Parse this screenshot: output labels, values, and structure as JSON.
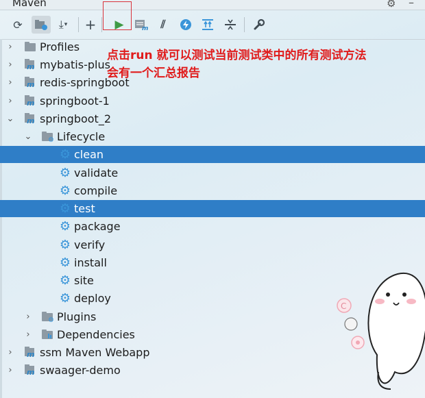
{
  "window": {
    "title": "Maven"
  },
  "toolbar": {
    "buttons": [
      {
        "name": "reload-icon",
        "glyph": "⟳"
      },
      {
        "name": "generate-sources-icon",
        "glyph": "▣"
      },
      {
        "name": "download-icon",
        "glyph": "⤓"
      },
      {
        "name": "add-icon",
        "glyph": "+"
      },
      {
        "name": "run-icon",
        "glyph": "▶"
      },
      {
        "name": "execute-goal-icon",
        "glyph": "▤"
      },
      {
        "name": "toggle-offline-icon",
        "glyph": "⫽"
      },
      {
        "name": "skip-tests-icon",
        "glyph": "⚡"
      },
      {
        "name": "show-dependencies-icon",
        "glyph": "⇅"
      },
      {
        "name": "collapse-all-icon",
        "glyph": "≑"
      },
      {
        "name": "settings-wrench-icon",
        "glyph": "🔧"
      }
    ],
    "run_color": "#3e9a45"
  },
  "annotation": {
    "line1": "点击run  就可以测试当前测试类中的所有测试方法",
    "line2": "会有一个汇总报告",
    "color": "#e01b1b"
  },
  "tree": {
    "profiles": "Profiles",
    "modules": [
      "mybatis-plus",
      "redis-springboot",
      "springboot-1",
      "springboot_2"
    ],
    "lifecycle": "Lifecycle",
    "phases": [
      "clean",
      "validate",
      "compile",
      "test",
      "package",
      "verify",
      "install",
      "site",
      "deploy"
    ],
    "selected_phases": [
      "clean",
      "test"
    ],
    "plugins": "Plugins",
    "dependencies": "Dependencies",
    "other_modules": [
      "ssm Maven Webapp",
      "swaager-demo"
    ]
  },
  "colors": {
    "selection": "#2f7ec7",
    "module_icon": "#2e87c9",
    "gear_icon": "#3a95d9"
  }
}
